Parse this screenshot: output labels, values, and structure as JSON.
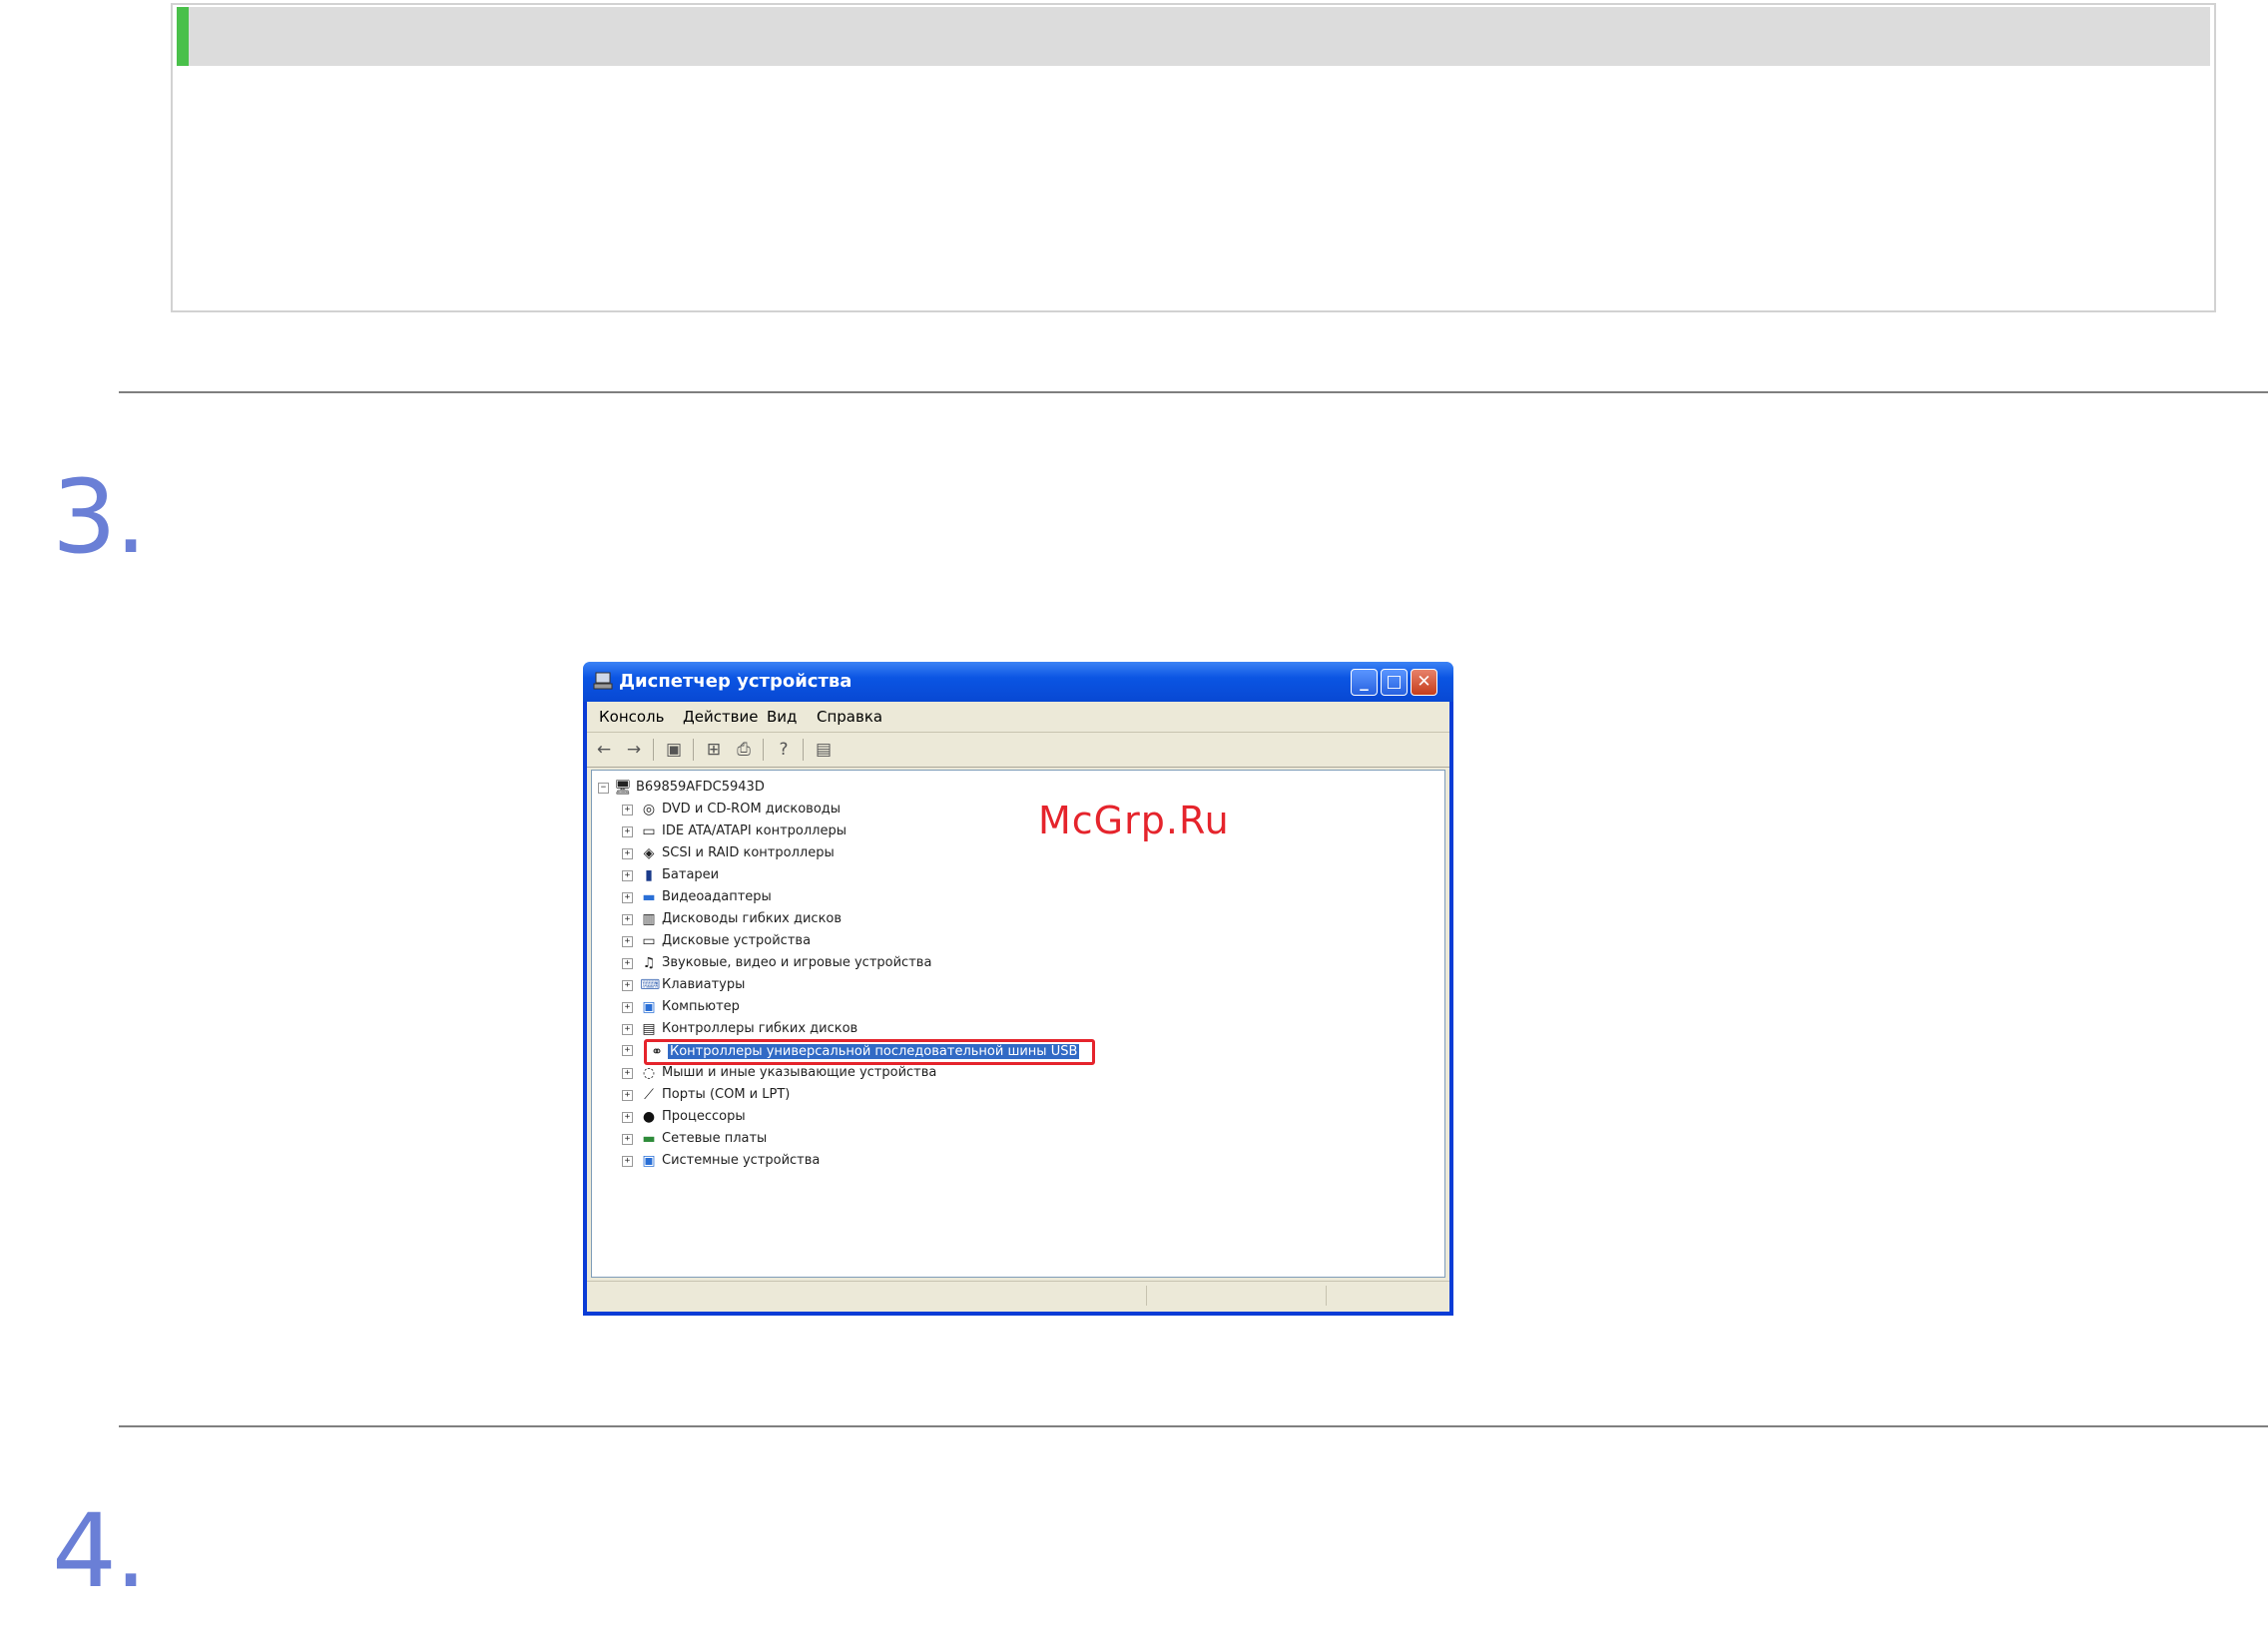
{
  "watermark": "McGrp.Ru",
  "steps": [
    {
      "number": "3."
    },
    {
      "number": "4."
    }
  ],
  "window": {
    "title": "Диспетчер устройства",
    "buttons": {
      "minimize": "_",
      "maximize": "□",
      "close": "✕"
    },
    "menu": [
      "Консоль",
      "Действие",
      "Вид",
      "Справка"
    ],
    "toolbar_icons": [
      "back-arrow-icon",
      "forward-arrow-icon",
      "properties-icon",
      "tree-icon",
      "print-icon",
      "help-icon",
      "scan-hardware-icon"
    ],
    "tree": {
      "root": "B69859AFDC5943D",
      "items": [
        {
          "label": "DVD и CD-ROM дисководы",
          "icon": "cdrom-icon"
        },
        {
          "label": "IDE ATA/ATAPI контроллеры",
          "icon": "ide-controller-icon"
        },
        {
          "label": "SCSI и RAID контроллеры",
          "icon": "scsi-icon"
        },
        {
          "label": "Батареи",
          "icon": "battery-icon"
        },
        {
          "label": "Видеоадаптеры",
          "icon": "display-adapter-icon"
        },
        {
          "label": "Дисководы гибких дисков",
          "icon": "floppy-drive-icon"
        },
        {
          "label": "Дисковые устройства",
          "icon": "disk-drive-icon"
        },
        {
          "label": "Звуковые, видео и игровые устройства",
          "icon": "sound-icon"
        },
        {
          "label": "Клавиатуры",
          "icon": "keyboard-icon"
        },
        {
          "label": "Компьютер",
          "icon": "computer-icon"
        },
        {
          "label": "Контроллеры гибких дисков",
          "icon": "floppy-controller-icon"
        },
        {
          "label": "Контроллеры универсальной последовательной шины USB",
          "icon": "usb-icon",
          "selected": true
        },
        {
          "label": "Мыши и иные указывающие устройства",
          "icon": "mouse-icon"
        },
        {
          "label": "Порты (COM и LPT)",
          "icon": "port-icon"
        },
        {
          "label": "Процессоры",
          "icon": "processor-icon"
        },
        {
          "label": "Сетевые платы",
          "icon": "network-card-icon"
        },
        {
          "label": "Системные устройства",
          "icon": "system-device-icon"
        }
      ]
    }
  },
  "colors": {
    "accent_green": "#49c04a",
    "step_number": "#6a7fd6",
    "watermark": "#e5242c",
    "xp_blue": "#0a3cd6",
    "selection": "#316ac5"
  }
}
